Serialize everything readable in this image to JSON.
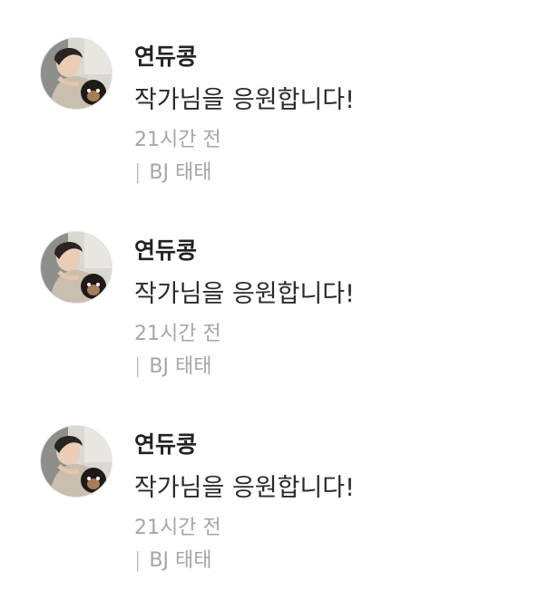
{
  "comments": [
    {
      "avatar_icon": "profile-photo-person-with-dog",
      "name": "연듀콩",
      "message": "작가님을 응원합니다!",
      "time": "21시간 전",
      "separator": "|",
      "author": "BJ 태태"
    },
    {
      "avatar_icon": "profile-photo-person-with-dog",
      "name": "연듀콩",
      "message": "작가님을 응원합니다!",
      "time": "21시간 전",
      "separator": "|",
      "author": "BJ 태태"
    },
    {
      "avatar_icon": "profile-photo-person-with-dog",
      "name": "연듀콩",
      "message": "작가님을 응원합니다!",
      "time": "21시간 전",
      "separator": "|",
      "author": "BJ 태태"
    }
  ],
  "colors": {
    "name": "#222222",
    "message": "#2a2a2a",
    "meta": "#a6a6a6",
    "background": "#ffffff"
  }
}
